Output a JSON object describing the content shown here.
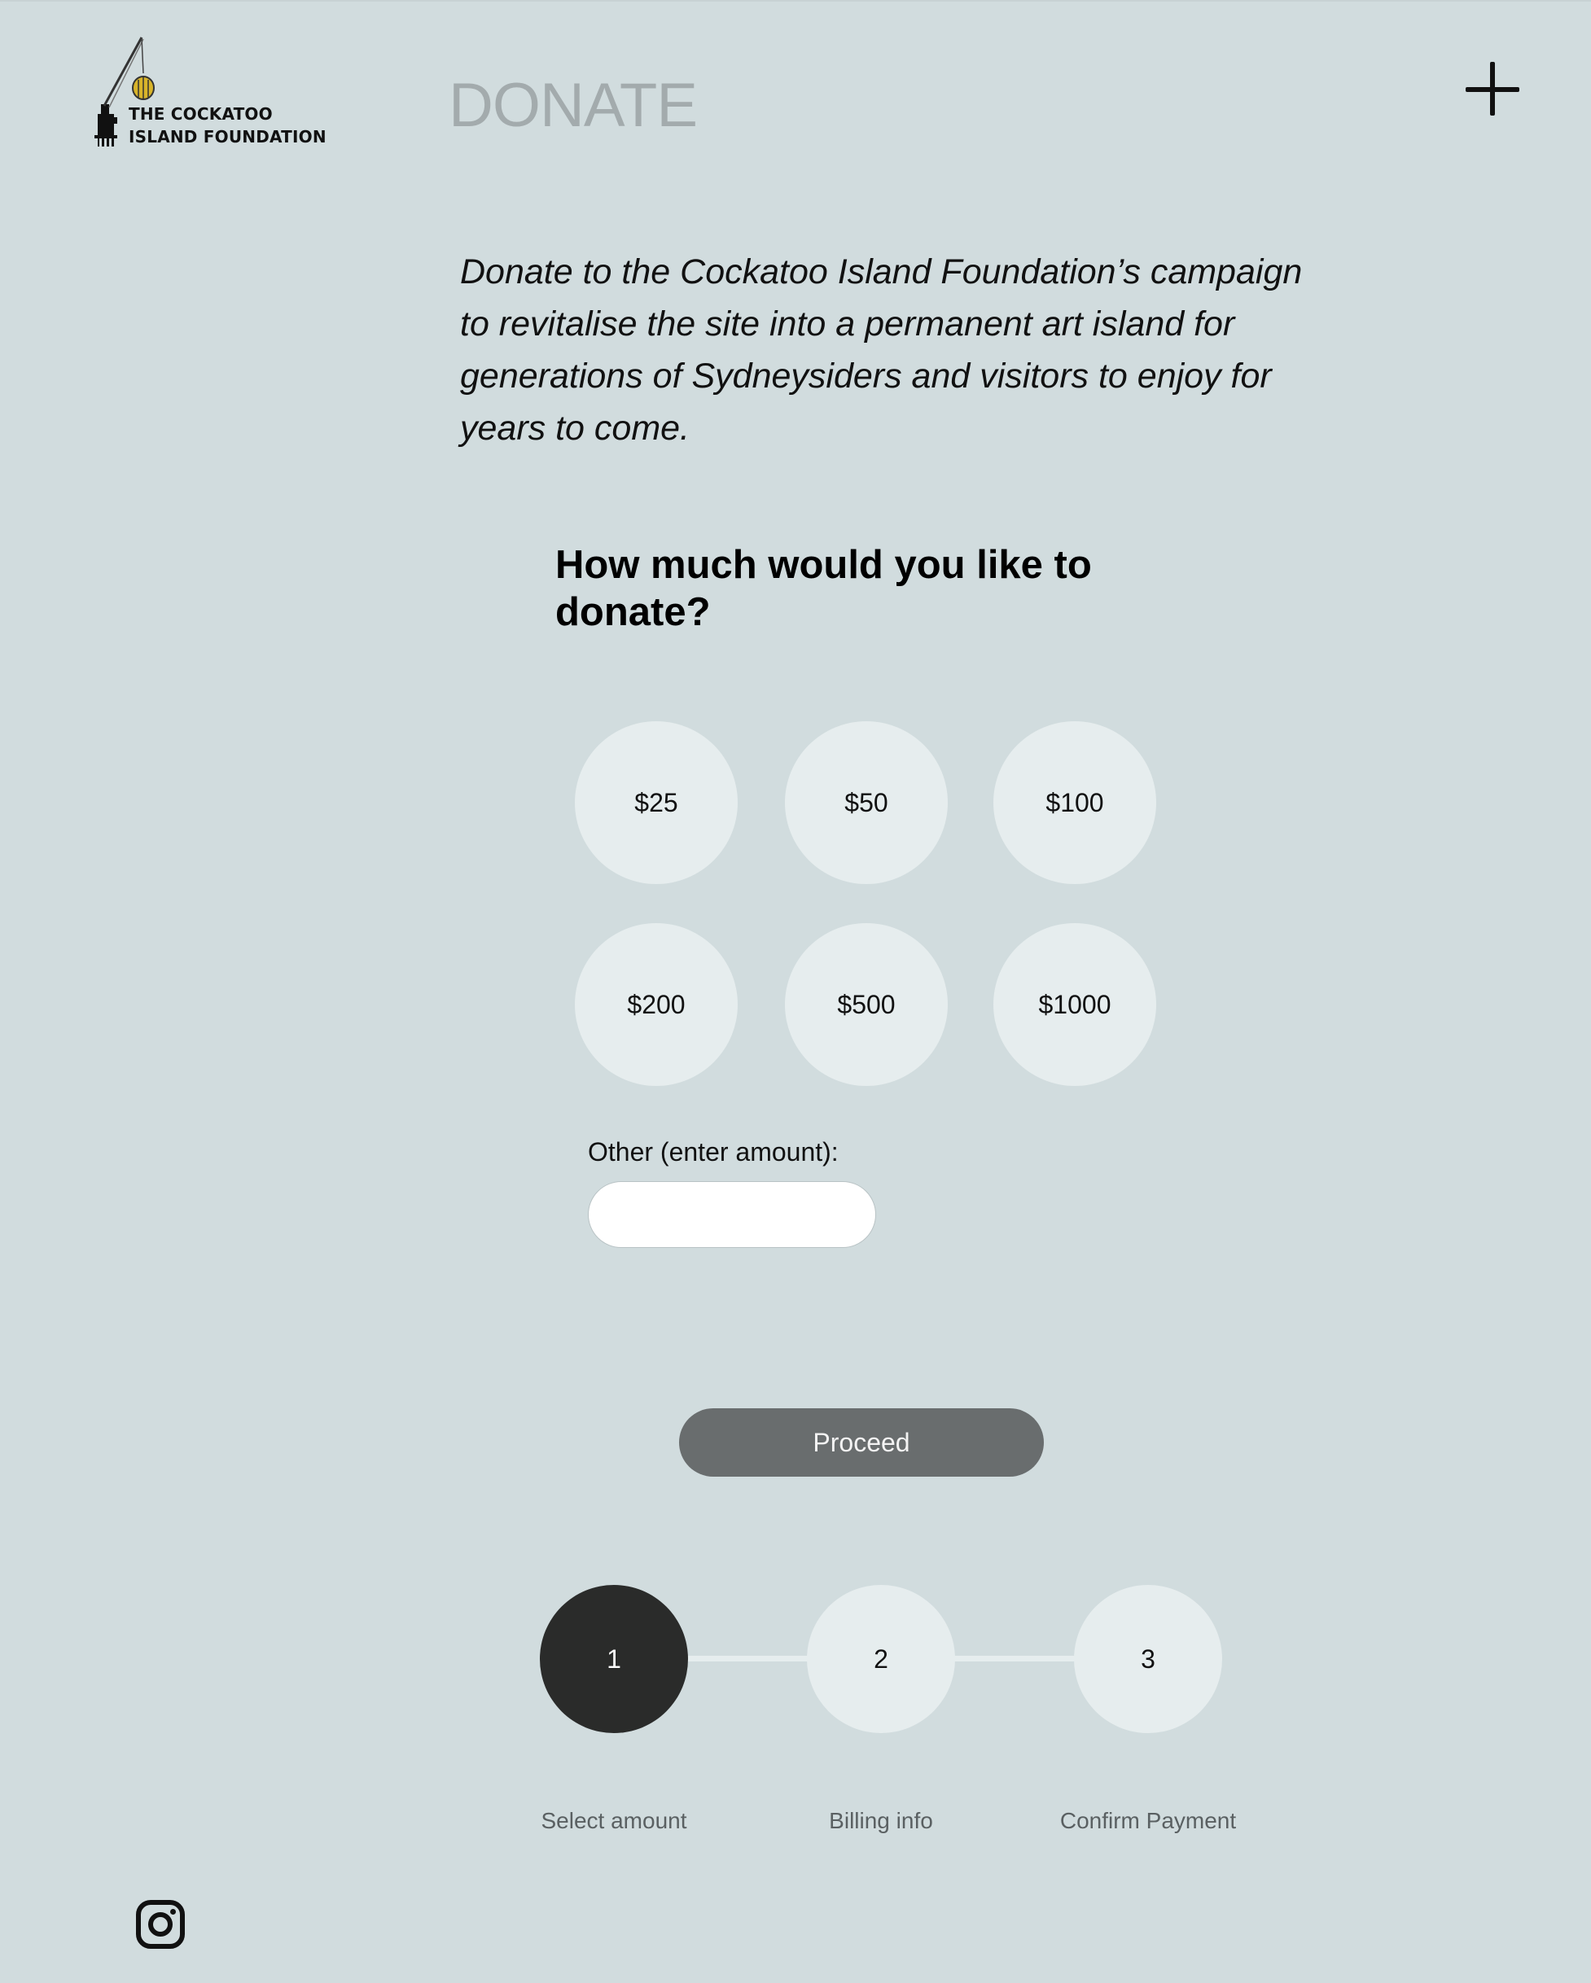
{
  "brand": {
    "name_line1": "THE COCKATOO",
    "name_line2": "ISLAND FOUNDATION"
  },
  "header": {
    "title": "DONATE",
    "menu_icon": "plus-icon"
  },
  "intro": {
    "text": "Donate to the Cockatoo Island Foundation’s campaign to revitalise the site into a permanent art island for generations of Sydneysiders and visitors to enjoy for years to come."
  },
  "donation": {
    "question": "How much would you like to donate?",
    "amounts": [
      "$25",
      "$50",
      "$100",
      "$200",
      "$500",
      "$1000"
    ],
    "other_label": "Other (enter amount):",
    "other_value": "",
    "proceed_label": "Proceed"
  },
  "steps": [
    {
      "number": "1",
      "label": "Select amount",
      "active": true
    },
    {
      "number": "2",
      "label": "Billing info",
      "active": false
    },
    {
      "number": "3",
      "label": "Confirm Payment",
      "active": false
    }
  ],
  "footer": {
    "social_icon": "instagram-icon"
  },
  "colors": {
    "background": "#d1dcde",
    "circle": "#e6edee",
    "active_step": "#2a2b2a",
    "proceed_button": "#696d6e",
    "title_gray": "#a3abad"
  }
}
